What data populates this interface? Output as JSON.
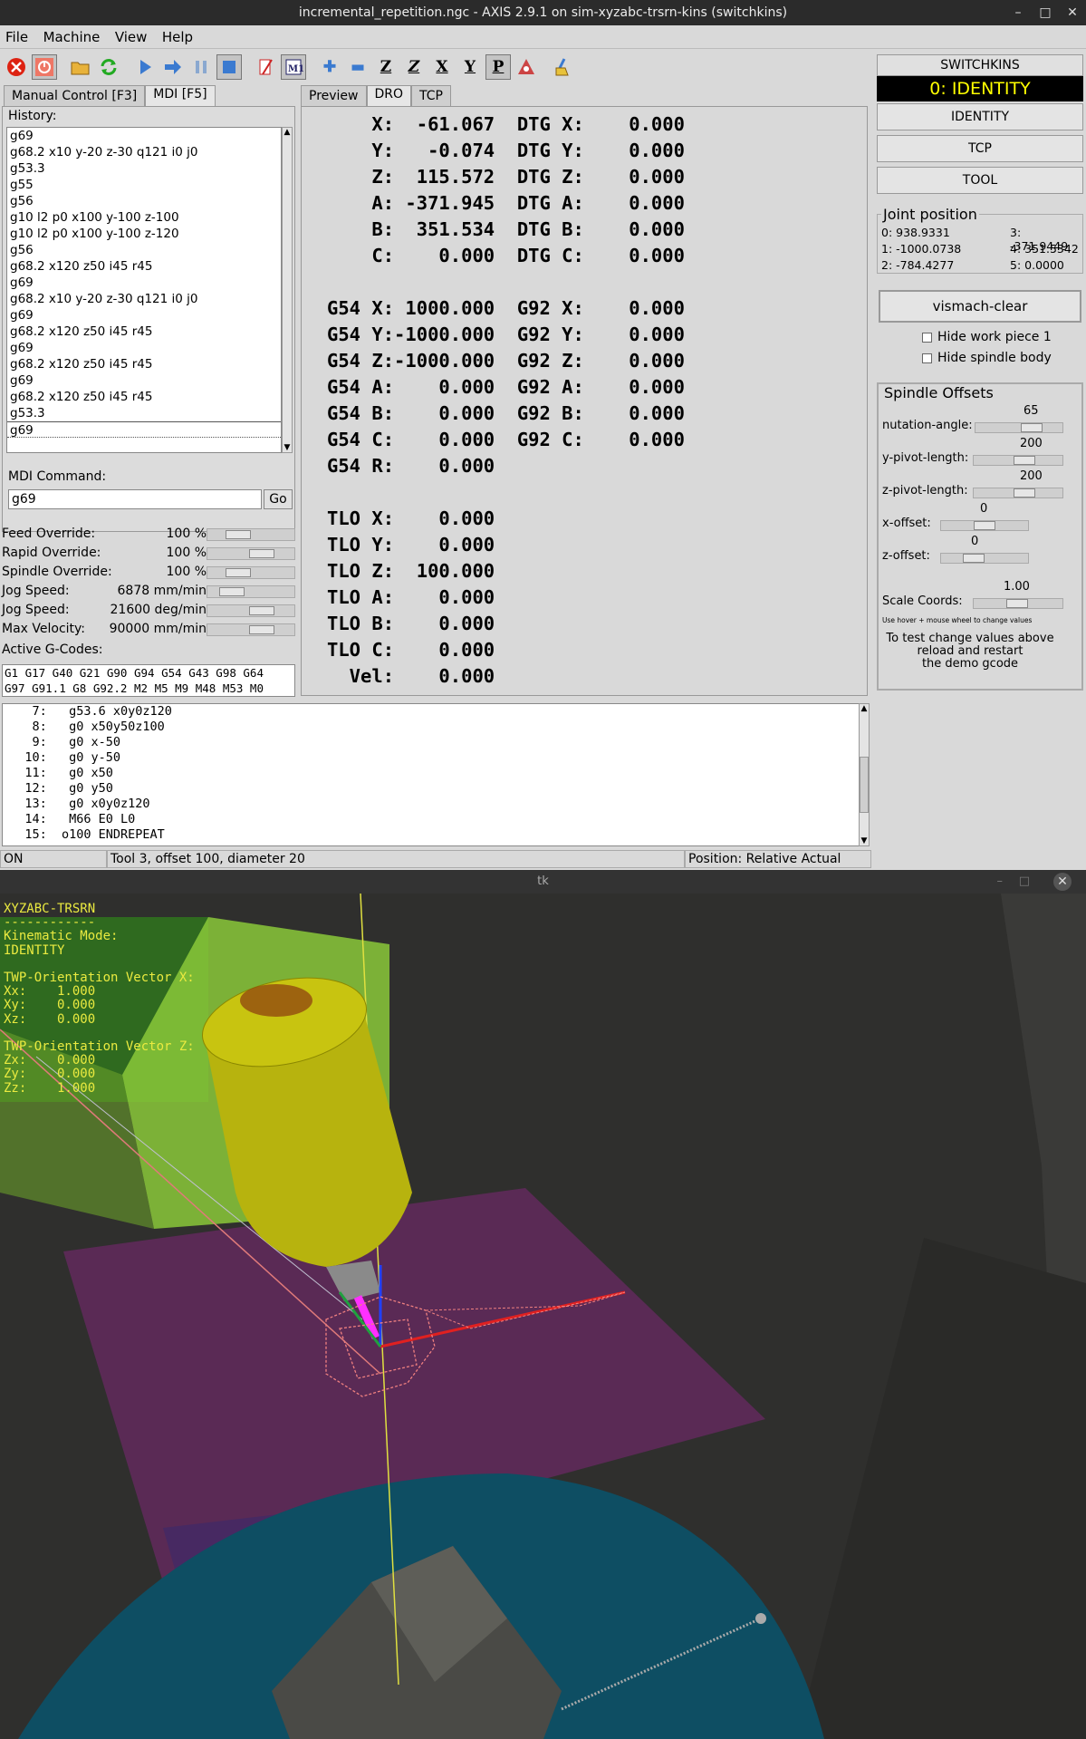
{
  "window": {
    "title": "incremental_repetition.ngc - AXIS 2.9.1 on sim-xyzabc-trsrn-kins (switchkins)"
  },
  "menu": [
    "File",
    "Machine",
    "View",
    "Help"
  ],
  "tabs_left": {
    "manual": "Manual Control [F3]",
    "mdi": "MDI [F5]"
  },
  "history": {
    "label": "History:",
    "items": [
      "g69",
      "g68.2 x10 y-20 z-30 q121 i0 j0",
      "g53.3",
      "g55",
      "g56",
      "g10 l2 p0 x100 y-100 z-100",
      "g10 l2 p0 x100 y-100 z-120",
      "g56",
      "g68.2 x120 z50  i45 r45",
      "g69",
      "g68.2 x10 y-20 z-30 q121 i0 j0",
      "g69",
      "g68.2 x120 z50  i45 r45",
      "g69",
      "g68.2 x120 z50  i45 r45",
      "g69",
      "g68.2 x120 z50  i45 r45",
      "g53.3",
      "g69"
    ]
  },
  "mdi": {
    "label": "MDI Command:",
    "value": "g69",
    "go": "Go"
  },
  "overrides": [
    {
      "name": "Feed Override:",
      "value": "100 %",
      "pos": 0.3
    },
    {
      "name": "Rapid Override:",
      "value": "100 %",
      "pos": 0.7
    },
    {
      "name": "Spindle Override:",
      "value": "100 %",
      "pos": 0.3
    },
    {
      "name": "Jog Speed:",
      "value": "6878 mm/min",
      "pos": 0.2
    },
    {
      "name": "Jog Speed:",
      "value": "21600 deg/min",
      "pos": 0.7
    },
    {
      "name": "Max Velocity:",
      "value": "90000 mm/min",
      "pos": 0.7
    }
  ],
  "active_gcodes": {
    "label": "Active G-Codes:",
    "line1": "G1 G17 G40 G21 G90 G94 G54 G43 G98 G64",
    "line2": "G97 G91.1 G8 G92.2 M2 M5 M9 M48 M53 M0"
  },
  "tabs_center": [
    "Preview",
    "DRO",
    "TCP"
  ],
  "dro": [
    "    X:  -61.067  DTG X:    0.000",
    "    Y:   -0.074  DTG Y:    0.000",
    "    Z:  115.572  DTG Z:    0.000",
    "    A: -371.945  DTG A:    0.000",
    "    B:  351.534  DTG B:    0.000",
    "    C:    0.000  DTG C:    0.000",
    "",
    "G54 X: 1000.000  G92 X:    0.000",
    "G54 Y:-1000.000  G92 Y:    0.000",
    "G54 Z:-1000.000  G92 Z:    0.000",
    "G54 A:    0.000  G92 A:    0.000",
    "G54 B:    0.000  G92 B:    0.000",
    "G54 C:    0.000  G92 C:    0.000",
    "G54 R:    0.000",
    "",
    "TLO X:    0.000",
    "TLO Y:    0.000",
    "TLO Z:  100.000",
    "TLO A:    0.000",
    "TLO B:    0.000",
    "TLO C:    0.000",
    "  Vel:    0.000"
  ],
  "switchkins": {
    "title": "SWITCHKINS",
    "mode": "0: IDENTITY",
    "buttons": [
      "IDENTITY",
      "TCP",
      "TOOL"
    ]
  },
  "joint_position": {
    "title": "Joint position",
    "values": [
      "0:  938.9331",
      "1:  -1000.0738",
      "2:  -784.4277",
      "3:  -371.9449",
      "4:  351.5342",
      "5:  0.0000"
    ]
  },
  "vismach": {
    "clear": "vismach-clear",
    "hide_work": "Hide work piece 1",
    "hide_spindle": "Hide spindle body"
  },
  "spindle_offsets": {
    "title": "Spindle Offsets",
    "rows": [
      {
        "label": "nutation-angle:",
        "value": "65"
      },
      {
        "label": "y-pivot-length:",
        "value": "200"
      },
      {
        "label": "z-pivot-length:",
        "value": "200"
      },
      {
        "label": "x-offset:",
        "value": "0"
      },
      {
        "label": "z-offset:",
        "value": "0"
      },
      {
        "label": "Scale Coords:",
        "value": "1.00"
      }
    ],
    "hint": "Use hover + mouse wheel to change values",
    "note": [
      "To test change values above",
      "reload and restart",
      "the demo gcode"
    ]
  },
  "gcode_lines": [
    "    7:   g53.6 x0y0z120",
    "    8:   g0 x50y50z100",
    "    9:   g0 x-50",
    "   10:   g0 y-50",
    "   11:   g0 x50",
    "   12:   g0 y50",
    "   13:   g0 x0y0z120",
    "   14:   M66 E0 L0",
    "   15:  o100 ENDREPEAT"
  ],
  "status": {
    "state": "ON",
    "tool": "Tool 3, offset 100, diameter 20",
    "position": "Position: Relative Actual"
  },
  "tk": {
    "title": "tk",
    "hud": "XYZABC-TRSRN\n------------\nKinematic Mode:\nIDENTITY\n\nTWP-Orientation Vector X:\nXx:    1.000\nXy:    0.000\nXz:    0.000\n\nTWP-Orientation Vector Z:\nZx:    0.000\nZy:    0.000\nZz:    1.000"
  },
  "colors": {
    "mode_bg": "#000000",
    "mode_fg": "#ffff00",
    "hud": "#eaea40",
    "table": "#0e4e63",
    "plate": "#5a2a55"
  }
}
